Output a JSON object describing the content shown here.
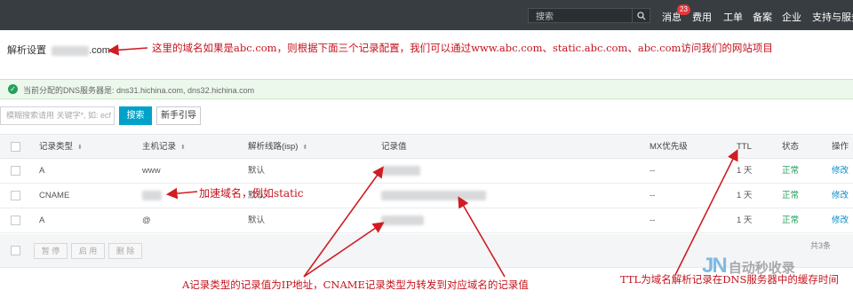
{
  "topbar": {
    "search_placeholder": "搜索",
    "nav": [
      {
        "label": "消息"
      },
      {
        "label": "费用"
      },
      {
        "label": "工单"
      },
      {
        "label": "备案"
      },
      {
        "label": "企业"
      },
      {
        "label": "支持与服务"
      }
    ],
    "badge": "23"
  },
  "domain": {
    "label": "解析设置",
    "suffix": ".com"
  },
  "notice": {
    "text": "当前分配的DNS服务器是:  dns31.hichina.com, dns32.hichina.com"
  },
  "toolbar": {
    "filter_placeholder": "模糊搜索请用 关键字*, 如: ecf",
    "search_label": "搜索",
    "guide_label": "新手引导"
  },
  "table": {
    "columns": [
      "记录类型",
      "主机记录",
      "解析线路(isp)",
      "记录值",
      "MX优先级",
      "TTL",
      "状态",
      "操作"
    ],
    "rows": [
      {
        "type": "A",
        "host": "www",
        "line": "默认",
        "mx": "--",
        "ttl": "1 天",
        "status": "正常",
        "action": "修改"
      },
      {
        "type": "CNAME",
        "host": "",
        "line": "默认",
        "mx": "--",
        "ttl": "1 天",
        "status": "正常",
        "action": "修改"
      },
      {
        "type": "A",
        "host": "@",
        "line": "默认",
        "mx": "--",
        "ttl": "1 天",
        "status": "正常",
        "action": "修改"
      }
    ]
  },
  "footer": {
    "pause": "暂 停",
    "enable": "启 用",
    "delete": "删 除",
    "right_text": "共3条"
  },
  "annotations": {
    "domain_note": "这里的域名如果是abc.com，则根据下面三个记录配置，我们可以通过www.abc.com、static.abc.com、abc.com访问我们的网站项目",
    "cname_note": "加速域名，例如static",
    "record_value_note": "A记录类型的记录值为IP地址，CNAME记录类型为转发到对应域名的记录值",
    "ttl_note": "TTL为域名解析记录在DNS服务器中的缓存时间"
  },
  "watermark": {
    "text": "自动秒收录",
    "logo": "JN"
  },
  "colors": {
    "topbar": "#373d41",
    "primary": "#00a2ca",
    "annotation": "#c4131c",
    "status_ok": "#1f9d55",
    "link": "#0a8bc6"
  }
}
